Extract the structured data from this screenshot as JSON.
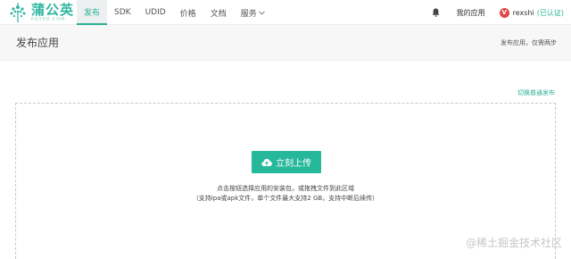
{
  "brand": {
    "name_cn": "蒲公英",
    "name_en": "PGYER.COM",
    "color": "#2fb6a0"
  },
  "nav": {
    "items": [
      {
        "label": "发布",
        "active": true
      },
      {
        "label": "SDK"
      },
      {
        "label": "UDID"
      },
      {
        "label": "价格"
      },
      {
        "label": "文档"
      },
      {
        "label": "服务",
        "dropdown": true
      }
    ]
  },
  "user": {
    "notifications_icon": "bell-icon",
    "my_apps": "我的应用",
    "avatar_letter": "V",
    "username": "rexshi",
    "status": "(已认证)"
  },
  "page": {
    "title": "发布应用",
    "subtitle": "发布应用，仅需两步",
    "switch_link": "切换普通发布"
  },
  "upload": {
    "button_label": "立刻上传",
    "icon": "cloud-upload-icon",
    "hint_line1": "点击按钮选择应用的安装包，或拖拽文件到此区域",
    "hint_line2": "（支持ipa或apk文件，单个文件最大支持2 GB，支持中断后续传）",
    "accent_color": "#26b89a"
  },
  "watermark": "@稀土掘金技术社区"
}
